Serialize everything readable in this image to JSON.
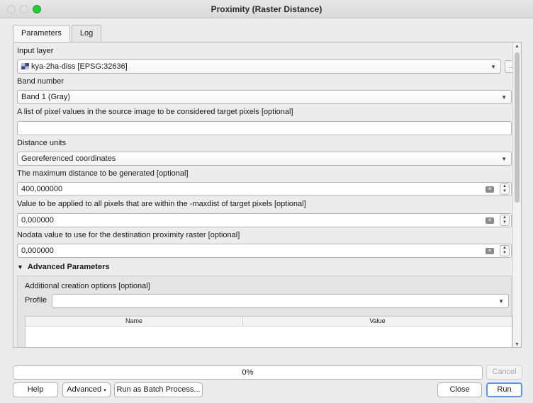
{
  "window": {
    "title": "Proximity (Raster Distance)"
  },
  "tabs": [
    {
      "label": "Parameters",
      "active": true
    },
    {
      "label": "Log",
      "active": false
    }
  ],
  "params": {
    "input_layer_label": "Input layer",
    "input_layer_value": "kya-2ha-diss [EPSG:32636]",
    "ellipsis_label": "…",
    "band_label": "Band number",
    "band_value": "Band 1 (Gray)",
    "values_label": "A list of pixel values in the source image to be considered target pixels [optional]",
    "values_value": "",
    "units_label": "Distance units",
    "units_value": "Georeferenced coordinates",
    "maxdist_label": "The maximum distance to be generated [optional]",
    "maxdist_value": "400,000000",
    "replace_label": "Value to be applied to all pixels that are within the -maxdist of target pixels [optional]",
    "replace_value": "0,000000",
    "nodata_label": "Nodata value to use for the destination proximity raster [optional]",
    "nodata_value": "0,000000"
  },
  "advanced": {
    "header": "Advanced Parameters",
    "creation_label": "Additional creation options [optional]",
    "profile_label": "Profile",
    "profile_value": "",
    "table_columns": [
      "Name",
      "Value"
    ]
  },
  "progress": {
    "text": "0%",
    "value": 0
  },
  "buttons": {
    "cancel": "Cancel",
    "help": "Help",
    "advanced": "Advanced",
    "batch": "Run as Batch Process...",
    "close": "Close",
    "run": "Run"
  },
  "colors": {
    "accent": "#5a95e8",
    "maximize": "#2ac840"
  },
  "icons": {
    "dropdown": "chevron-down-icon",
    "clear": "clear-backspace-icon",
    "spin": "spin-up-down-icon",
    "layer": "raster-layer-icon",
    "collapse": "triangle-down-icon"
  }
}
